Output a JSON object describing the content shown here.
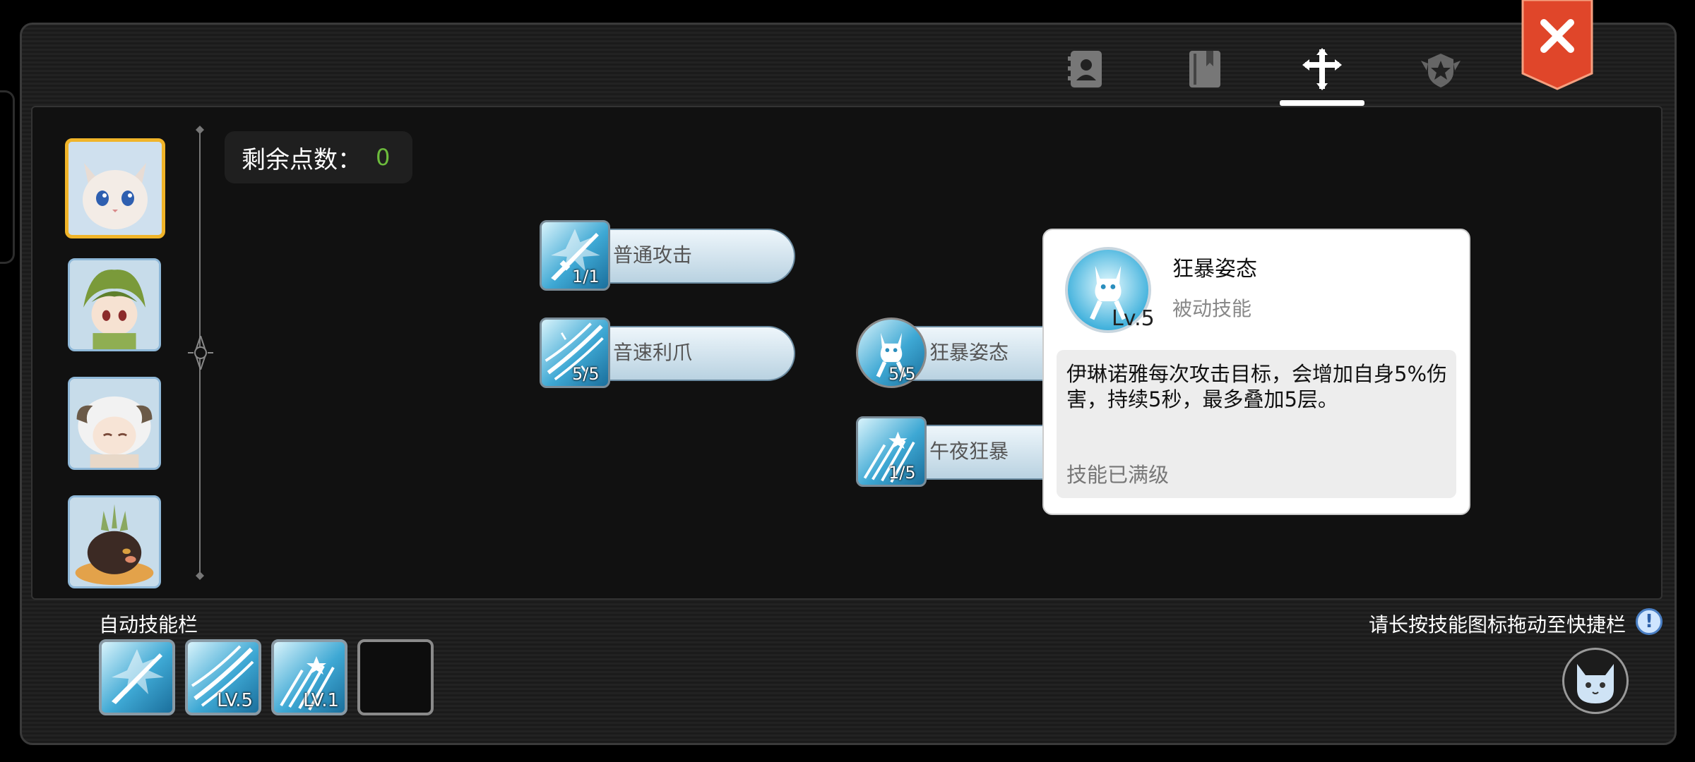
{
  "tabs": [
    {
      "icon": "contacts-book-icon"
    },
    {
      "icon": "bookmark-book-icon"
    },
    {
      "icon": "skill-cross-icon",
      "active": true
    },
    {
      "icon": "star-emblem-icon"
    }
  ],
  "close": {
    "icon": "close-icon"
  },
  "points": {
    "label": "剩余点数：",
    "value": "0"
  },
  "skills": {
    "normal_attack": {
      "name": "普通攻击",
      "level": "1/1"
    },
    "sonic_claw": {
      "name": "音速利爪",
      "level": "5/5"
    },
    "berserk_stance": {
      "name": "狂暴姿态",
      "level": "5/5"
    },
    "midnight_frenzy": {
      "name": "午夜狂暴",
      "level": "1/5"
    }
  },
  "tooltip": {
    "name": "狂暴姿态",
    "type": "被动技能",
    "level": "Lv.5",
    "description": "伊琳诺雅每次攻击目标，会增加自身5%伤害，持续5秒，最多叠加5层。",
    "status": "技能已满级"
  },
  "auto_bar": {
    "label": "自动技能栏",
    "slots": [
      {
        "icon": "sword-skill-icon",
        "level": ""
      },
      {
        "icon": "claw-skill-icon",
        "level": "LV.5"
      },
      {
        "icon": "frenzy-skill-icon",
        "level": "LV.1"
      },
      {
        "icon": "empty-slot",
        "level": ""
      }
    ]
  },
  "hint": {
    "text": "请长按技能图标拖动至快捷栏",
    "icon": "!"
  },
  "colors": {
    "points_value": "#6cbb3c",
    "selected_border": "#f0b429",
    "close_red": "#e0462a"
  }
}
